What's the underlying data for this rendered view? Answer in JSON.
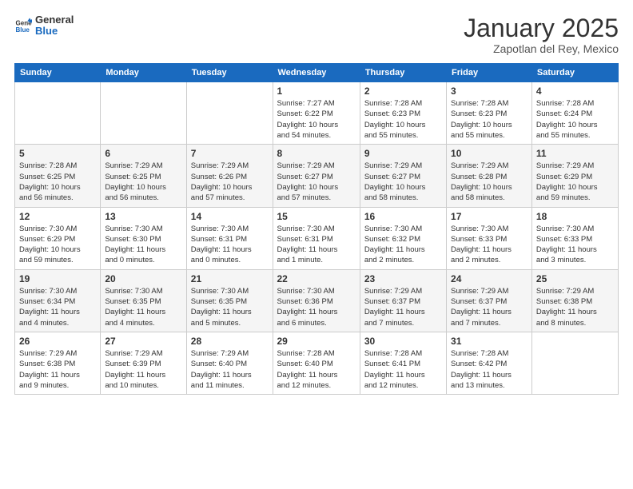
{
  "logo": {
    "general": "General",
    "blue": "Blue"
  },
  "title": "January 2025",
  "location": "Zapotlan del Rey, Mexico",
  "days_header": [
    "Sunday",
    "Monday",
    "Tuesday",
    "Wednesday",
    "Thursday",
    "Friday",
    "Saturday"
  ],
  "weeks": [
    [
      {
        "day": "",
        "info": ""
      },
      {
        "day": "",
        "info": ""
      },
      {
        "day": "",
        "info": ""
      },
      {
        "day": "1",
        "info": "Sunrise: 7:27 AM\nSunset: 6:22 PM\nDaylight: 10 hours\nand 54 minutes."
      },
      {
        "day": "2",
        "info": "Sunrise: 7:28 AM\nSunset: 6:23 PM\nDaylight: 10 hours\nand 55 minutes."
      },
      {
        "day": "3",
        "info": "Sunrise: 7:28 AM\nSunset: 6:23 PM\nDaylight: 10 hours\nand 55 minutes."
      },
      {
        "day": "4",
        "info": "Sunrise: 7:28 AM\nSunset: 6:24 PM\nDaylight: 10 hours\nand 55 minutes."
      }
    ],
    [
      {
        "day": "5",
        "info": "Sunrise: 7:28 AM\nSunset: 6:25 PM\nDaylight: 10 hours\nand 56 minutes."
      },
      {
        "day": "6",
        "info": "Sunrise: 7:29 AM\nSunset: 6:25 PM\nDaylight: 10 hours\nand 56 minutes."
      },
      {
        "day": "7",
        "info": "Sunrise: 7:29 AM\nSunset: 6:26 PM\nDaylight: 10 hours\nand 57 minutes."
      },
      {
        "day": "8",
        "info": "Sunrise: 7:29 AM\nSunset: 6:27 PM\nDaylight: 10 hours\nand 57 minutes."
      },
      {
        "day": "9",
        "info": "Sunrise: 7:29 AM\nSunset: 6:27 PM\nDaylight: 10 hours\nand 58 minutes."
      },
      {
        "day": "10",
        "info": "Sunrise: 7:29 AM\nSunset: 6:28 PM\nDaylight: 10 hours\nand 58 minutes."
      },
      {
        "day": "11",
        "info": "Sunrise: 7:29 AM\nSunset: 6:29 PM\nDaylight: 10 hours\nand 59 minutes."
      }
    ],
    [
      {
        "day": "12",
        "info": "Sunrise: 7:30 AM\nSunset: 6:29 PM\nDaylight: 10 hours\nand 59 minutes."
      },
      {
        "day": "13",
        "info": "Sunrise: 7:30 AM\nSunset: 6:30 PM\nDaylight: 11 hours\nand 0 minutes."
      },
      {
        "day": "14",
        "info": "Sunrise: 7:30 AM\nSunset: 6:31 PM\nDaylight: 11 hours\nand 0 minutes."
      },
      {
        "day": "15",
        "info": "Sunrise: 7:30 AM\nSunset: 6:31 PM\nDaylight: 11 hours\nand 1 minute."
      },
      {
        "day": "16",
        "info": "Sunrise: 7:30 AM\nSunset: 6:32 PM\nDaylight: 11 hours\nand 2 minutes."
      },
      {
        "day": "17",
        "info": "Sunrise: 7:30 AM\nSunset: 6:33 PM\nDaylight: 11 hours\nand 2 minutes."
      },
      {
        "day": "18",
        "info": "Sunrise: 7:30 AM\nSunset: 6:33 PM\nDaylight: 11 hours\nand 3 minutes."
      }
    ],
    [
      {
        "day": "19",
        "info": "Sunrise: 7:30 AM\nSunset: 6:34 PM\nDaylight: 11 hours\nand 4 minutes."
      },
      {
        "day": "20",
        "info": "Sunrise: 7:30 AM\nSunset: 6:35 PM\nDaylight: 11 hours\nand 4 minutes."
      },
      {
        "day": "21",
        "info": "Sunrise: 7:30 AM\nSunset: 6:35 PM\nDaylight: 11 hours\nand 5 minutes."
      },
      {
        "day": "22",
        "info": "Sunrise: 7:30 AM\nSunset: 6:36 PM\nDaylight: 11 hours\nand 6 minutes."
      },
      {
        "day": "23",
        "info": "Sunrise: 7:29 AM\nSunset: 6:37 PM\nDaylight: 11 hours\nand 7 minutes."
      },
      {
        "day": "24",
        "info": "Sunrise: 7:29 AM\nSunset: 6:37 PM\nDaylight: 11 hours\nand 7 minutes."
      },
      {
        "day": "25",
        "info": "Sunrise: 7:29 AM\nSunset: 6:38 PM\nDaylight: 11 hours\nand 8 minutes."
      }
    ],
    [
      {
        "day": "26",
        "info": "Sunrise: 7:29 AM\nSunset: 6:38 PM\nDaylight: 11 hours\nand 9 minutes."
      },
      {
        "day": "27",
        "info": "Sunrise: 7:29 AM\nSunset: 6:39 PM\nDaylight: 11 hours\nand 10 minutes."
      },
      {
        "day": "28",
        "info": "Sunrise: 7:29 AM\nSunset: 6:40 PM\nDaylight: 11 hours\nand 11 minutes."
      },
      {
        "day": "29",
        "info": "Sunrise: 7:28 AM\nSunset: 6:40 PM\nDaylight: 11 hours\nand 12 minutes."
      },
      {
        "day": "30",
        "info": "Sunrise: 7:28 AM\nSunset: 6:41 PM\nDaylight: 11 hours\nand 12 minutes."
      },
      {
        "day": "31",
        "info": "Sunrise: 7:28 AM\nSunset: 6:42 PM\nDaylight: 11 hours\nand 13 minutes."
      },
      {
        "day": "",
        "info": ""
      }
    ]
  ]
}
